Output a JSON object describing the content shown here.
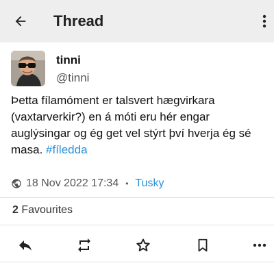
{
  "appbar": {
    "title": "Thread",
    "back_icon": "arrow-left-icon",
    "menu_icon": "more-vert-icon",
    "background": "#eeeeee"
  },
  "status": {
    "display_name": "tinni",
    "handle": "@tinni",
    "content": "Þetta fílamóment er talsvert hægvirkara (vaxtarverkir?) en á móti eru hér engar auglýsingar og ég get vel stýrt því hverja ég sé masa.",
    "hashtag": "#fíledda",
    "visibility_icon": "globe-icon",
    "timestamp": "18 Nov 2022 17:34",
    "separator": "•",
    "application": "Tusky",
    "favourites_count": "2",
    "favourites_label": "Favourites",
    "link_color": "#2b90d9"
  },
  "actions": [
    {
      "icon": "reply-icon"
    },
    {
      "icon": "boost-icon"
    },
    {
      "icon": "star-icon"
    },
    {
      "icon": "bookmark-icon"
    },
    {
      "icon": "more-horiz-icon"
    }
  ]
}
